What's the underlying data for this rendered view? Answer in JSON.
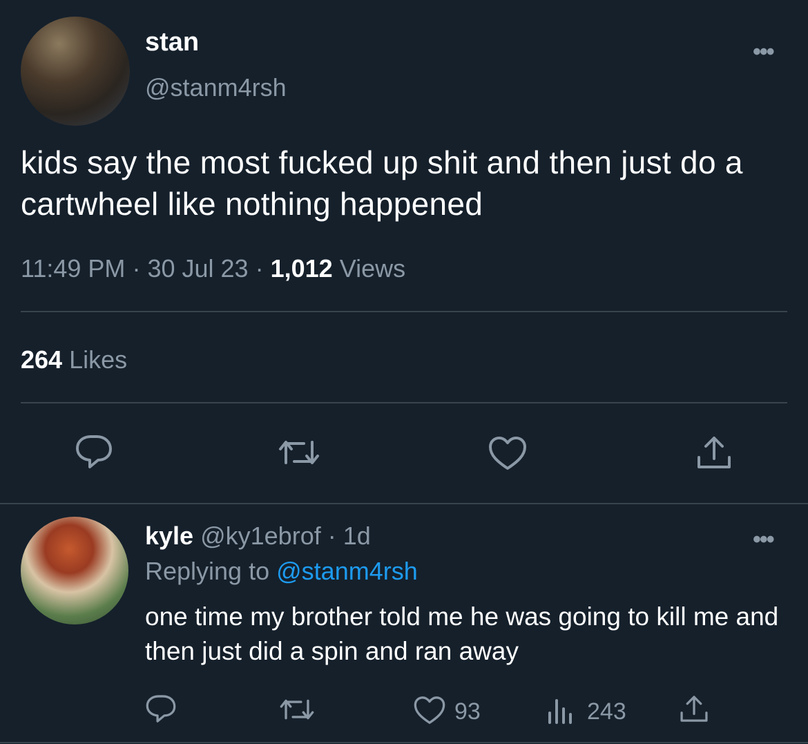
{
  "tweet": {
    "display_name": "stan",
    "handle": "@stanm4rsh",
    "text": "kids say the most fucked up shit and then just do a cartwheel like nothing happened",
    "time": "11:49 PM",
    "separator": "·",
    "date": "30 Jul 23",
    "views_count": "1,012",
    "views_label": "Views",
    "likes_count": "264",
    "likes_label": "Likes",
    "more_label": "•••"
  },
  "actions": {
    "icons": [
      "reply-icon",
      "retweet-icon",
      "like-icon",
      "share-icon"
    ]
  },
  "reply": {
    "display_name": "kyle",
    "handle": "@ky1ebrof",
    "separator": "·",
    "age": "1d",
    "replying_to_label": "Replying to",
    "replying_to_handle": "@stanm4rsh",
    "text": "one time my brother told me he was going to kill me and then just did a spin and ran away",
    "like_count": "93",
    "views_count": "243",
    "more_label": "•••"
  },
  "colors": {
    "background": "#15202b",
    "secondary_text": "#8b98a5",
    "link": "#1d9bf0",
    "divider": "#38444d"
  }
}
